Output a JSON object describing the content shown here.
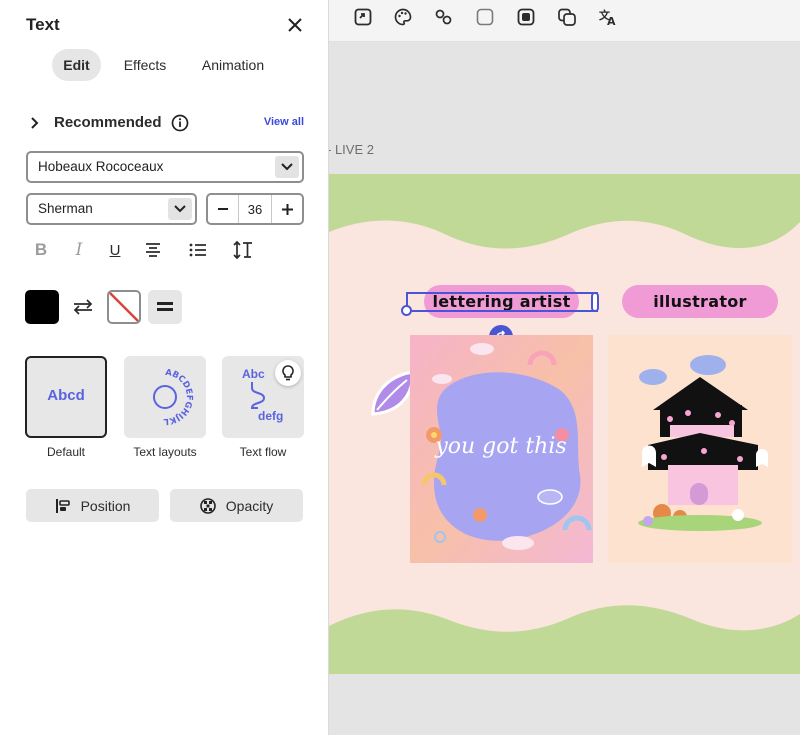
{
  "panel": {
    "title": "Text",
    "tabs": [
      {
        "label": "Edit",
        "active": true
      },
      {
        "label": "Effects"
      },
      {
        "label": "Animation"
      }
    ],
    "recommended": {
      "label": "Recommended",
      "view_all": "View all"
    },
    "font_family": "Hobeaux Rococeaux",
    "font_style": "Sherman",
    "font_size": "36",
    "format_buttons": [
      "bold-icon",
      "italic-icon",
      "underline-icon",
      "align-center-icon",
      "bullet-list-icon",
      "line-spacing-icon"
    ],
    "fill_color": "#000000",
    "text_presets": [
      {
        "label": "Default",
        "preview": "Abcd",
        "selected": true
      },
      {
        "label": "Text layouts",
        "preview": "ABCDEFGHIJKL"
      },
      {
        "label": "Text flow",
        "preview_top": "Abc",
        "preview_bottom": "defg"
      }
    ],
    "actions": {
      "position": "Position",
      "opacity": "Opacity"
    }
  },
  "toolbar": {
    "icons": [
      "replace-icon",
      "palette-icon",
      "link-icon",
      "shape-icon",
      "mask-icon",
      "duplicate-icon",
      "translate-icon"
    ]
  },
  "canvas": {
    "page_label": "- LIVE 2",
    "pills": {
      "left": "lettering artist",
      "right": "illustrator"
    },
    "artwork_text": "you got this"
  },
  "colors": {
    "accent": "#4a55d4",
    "pill": "#f09ad6",
    "green_wave": "#c1d996",
    "artboard_bg": "#fbe5df"
  }
}
